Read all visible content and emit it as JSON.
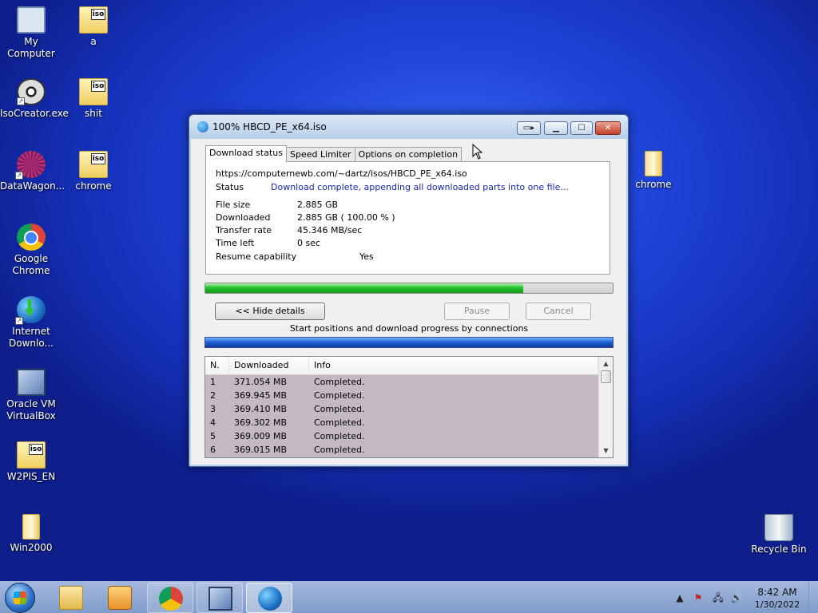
{
  "desktop": {
    "icons": [
      {
        "label": "My Computer",
        "icon": "computer-icon"
      },
      {
        "label": "a",
        "icon": "iso-folder-icon",
        "tag": "iso"
      },
      {
        "label": "IsoCreator.exe",
        "icon": "isocreator-icon"
      },
      {
        "label": "shit",
        "icon": "iso-folder-icon",
        "tag": "iso"
      },
      {
        "label": "DataWagon...",
        "icon": "datawagon-icon"
      },
      {
        "label": "chrome",
        "icon": "iso-folder-icon",
        "tag": "iso"
      },
      {
        "label": "Google Chrome",
        "icon": "chrome-icon"
      },
      {
        "label": "Internet Downlo...",
        "icon": "idm-icon"
      },
      {
        "label": "Oracle VM VirtualBox",
        "icon": "virtualbox-icon"
      },
      {
        "label": "W2PIS_EN",
        "icon": "iso-folder-icon",
        "tag": "iso"
      },
      {
        "label": "Win2000",
        "icon": "folder-icon"
      },
      {
        "label": "chrome",
        "icon": "folder-icon"
      },
      {
        "label": "Recycle Bin",
        "icon": "recycle-bin-icon"
      }
    ]
  },
  "window": {
    "title": "100% HBCD_PE_x64.iso",
    "title_buttons": {
      "minimize": "▁",
      "maximize": "☐",
      "close": "✕"
    },
    "tabs": [
      {
        "label": "Download status",
        "active": true
      },
      {
        "label": "Speed Limiter",
        "active": false
      },
      {
        "label": "Options on completion",
        "active": false
      }
    ],
    "url": "https://computernewb.com/~dartz/isos/HBCD_PE_x64.iso",
    "status_label": "Status",
    "status_value": "Download complete, appending all downloaded parts into one file...",
    "file_size_label": "File size",
    "file_size_value": "2.885  GB",
    "downloaded_label": "Downloaded",
    "downloaded_value": "2.885  GB  ( 100.00 % )",
    "transfer_rate_label": "Transfer rate",
    "transfer_rate_value": "45.346  MB/sec",
    "time_left_label": "Time left",
    "time_left_value": "0 sec",
    "resume_label": "Resume capability",
    "resume_value": "Yes",
    "progress_fraction": 0.78,
    "hide_details_label": "<< Hide details",
    "pause_label": "Pause",
    "cancel_label": "Cancel",
    "connections_label": "Start positions and download progress by connections",
    "list": {
      "columns": [
        "N.",
        "Downloaded",
        "Info"
      ],
      "rows": [
        {
          "n": "1",
          "downloaded": "371.054  MB",
          "info": "Completed."
        },
        {
          "n": "2",
          "downloaded": "369.945  MB",
          "info": "Completed."
        },
        {
          "n": "3",
          "downloaded": "369.410  MB",
          "info": "Completed."
        },
        {
          "n": "4",
          "downloaded": "369.302  MB",
          "info": "Completed."
        },
        {
          "n": "5",
          "downloaded": "369.009  MB",
          "info": "Completed."
        },
        {
          "n": "6",
          "downloaded": "369.015  MB",
          "info": "Completed."
        }
      ]
    }
  },
  "taskbar": {
    "apps": [
      "explorer-icon",
      "media-player-icon",
      "chrome-icon",
      "virtualbox-icon",
      "idm-icon"
    ],
    "active_app": "idm-icon",
    "clock_time": "8:42 AM",
    "clock_date": "1/30/2022"
  },
  "colors": {
    "status_text": "#1628b0",
    "progress_green": "#22c42a",
    "connections_blue": "#1d5fd4",
    "desktop_blue": "#1f45d9"
  }
}
